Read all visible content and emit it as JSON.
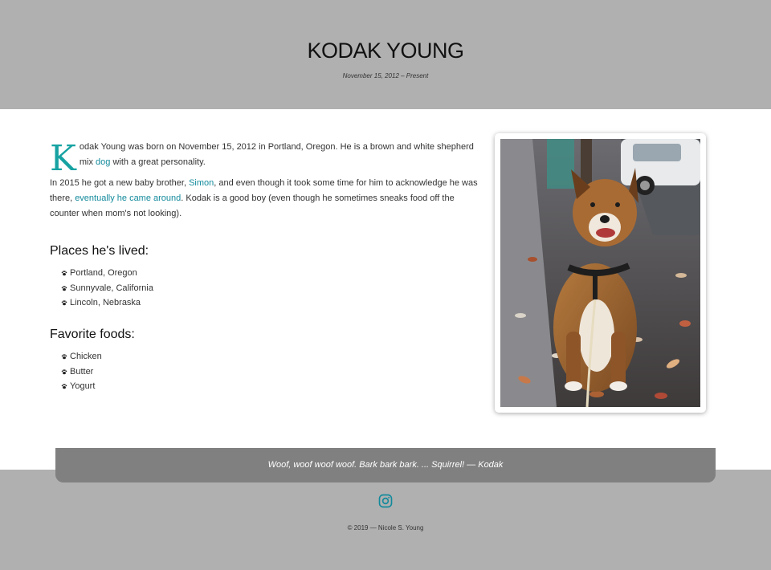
{
  "header": {
    "title": "KODAK YOUNG",
    "dates": "November 15, 2012 – Present"
  },
  "intro": {
    "dropcap": "K",
    "text_1": "odak Young was born on November 15, 2012 in Portland, Oregon. He is a brown and white shepherd mix ",
    "link_dog": "dog",
    "text_2": " with a great personality."
  },
  "para2": {
    "text_1": "In 2015 he got a new baby brother, ",
    "link_simon": "Simon",
    "text_2": ", and even though it took some time for him to acknowledge he was there, ",
    "link_around": "eventually he came around",
    "text_3": ". Kodak is a good boy (even though he sometimes sneaks food off the counter when mom's not looking)."
  },
  "places": {
    "heading": "Places he's lived:",
    "items": [
      "Portland, Oregon",
      "Sunnyvale, California",
      "Lincoln, Nebraska"
    ]
  },
  "foods": {
    "heading": "Favorite foods:",
    "items": [
      "Chicken",
      "Butter",
      "Yogurt"
    ]
  },
  "photo": {
    "subject": "brown and white shepherd mix dog on leash sitting on leaf-covered sidewalk"
  },
  "footer": {
    "quote": "Woof, woof woof woof. Bark bark bark. ... Squirrel! — Kodak",
    "copyright": "© 2019 — Nicole S. Young",
    "social_icon": "instagram-icon"
  },
  "colors": {
    "accent": "#138a9c",
    "dropcap": "#17a2a2",
    "header_bg": "#b0b0b0",
    "quote_bg": "#808080"
  }
}
